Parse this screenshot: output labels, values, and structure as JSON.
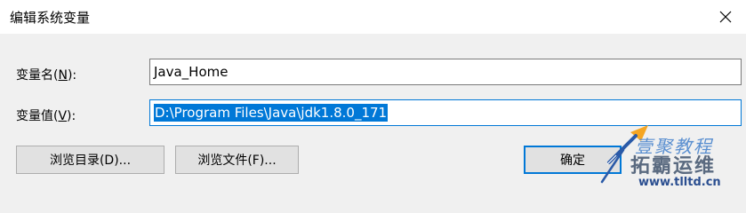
{
  "window": {
    "title": "编辑系统变量",
    "close_symbol": "✕"
  },
  "fields": {
    "name": {
      "label_prefix": "变量名(",
      "label_key": "N",
      "label_suffix": "):",
      "value": "Java_Home"
    },
    "value": {
      "label_prefix": "变量值(",
      "label_key": "V",
      "label_suffix": "):",
      "value": "D:\\Program Files\\Java\\jdk1.8.0_171"
    }
  },
  "buttons": {
    "browse_directory": "浏览目录(D)...",
    "browse_file": "浏览文件(F)...",
    "ok": "确定"
  },
  "watermark": {
    "line1": "壹聚教程",
    "line2": "拓霸运维",
    "url": "www.tlltd.cn"
  },
  "colors": {
    "accent": "#0078d7",
    "selection_text": "#ffffff",
    "dialog_background": "#f0f0f0"
  },
  "icons": {
    "close": "close-icon",
    "watermark_logo": "pen-arrow-logo-icon"
  }
}
